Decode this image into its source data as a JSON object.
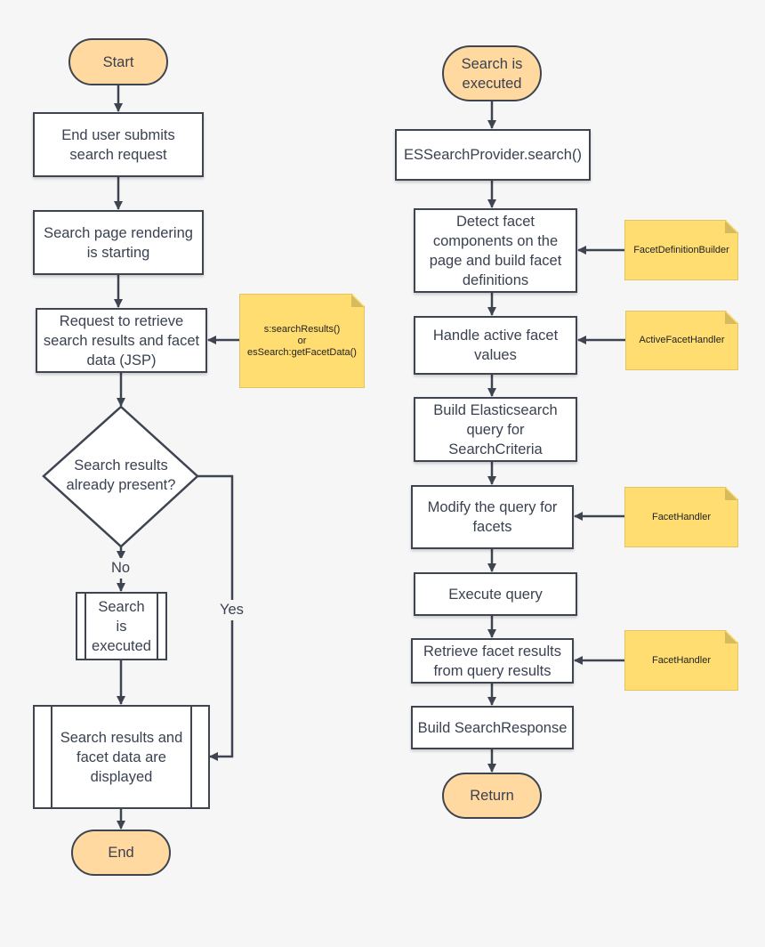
{
  "colors": {
    "background": "#f6f6f6",
    "stroke": "#3e4450",
    "terminal": "#ffd9a0",
    "note": "#ffdd71",
    "box": "#ffffff"
  },
  "left_flow": {
    "start": "Start",
    "step1": "End user submits\nsearch request",
    "step2": "Search page rendering\nis starting",
    "step3": "Request to retrieve\nsearch results and facet\ndata (JSP)",
    "note": "s:searchResults()\nor\nesSearch:getFacetData()",
    "decision": "Search results\nalready present?",
    "no_label": "No",
    "yes_label": "Yes",
    "subprocess": "Search\nis\nexecuted",
    "display": "Search results and\nfacet data are\ndisplayed",
    "end": "End"
  },
  "right_flow": {
    "start": "Search is\nexecuted",
    "step1": "ESSearchProvider.search()",
    "step2": "Detect facet\ncomponents on the\npage and build facet\ndefinitions",
    "note2": "FacetDefinitionBuilder",
    "step3": "Handle active facet\nvalues",
    "note3": "ActiveFacetHandler",
    "step4": "Build Elasticsearch\nquery for\nSearchCriteria",
    "step5": "Modify the query for\nfacets",
    "note5": "FacetHandler",
    "step6": "Execute query",
    "step7": "Retrieve facet results\nfrom query results",
    "note7": "FacetHandler",
    "step8": "Build SearchResponse",
    "end": "Return"
  }
}
